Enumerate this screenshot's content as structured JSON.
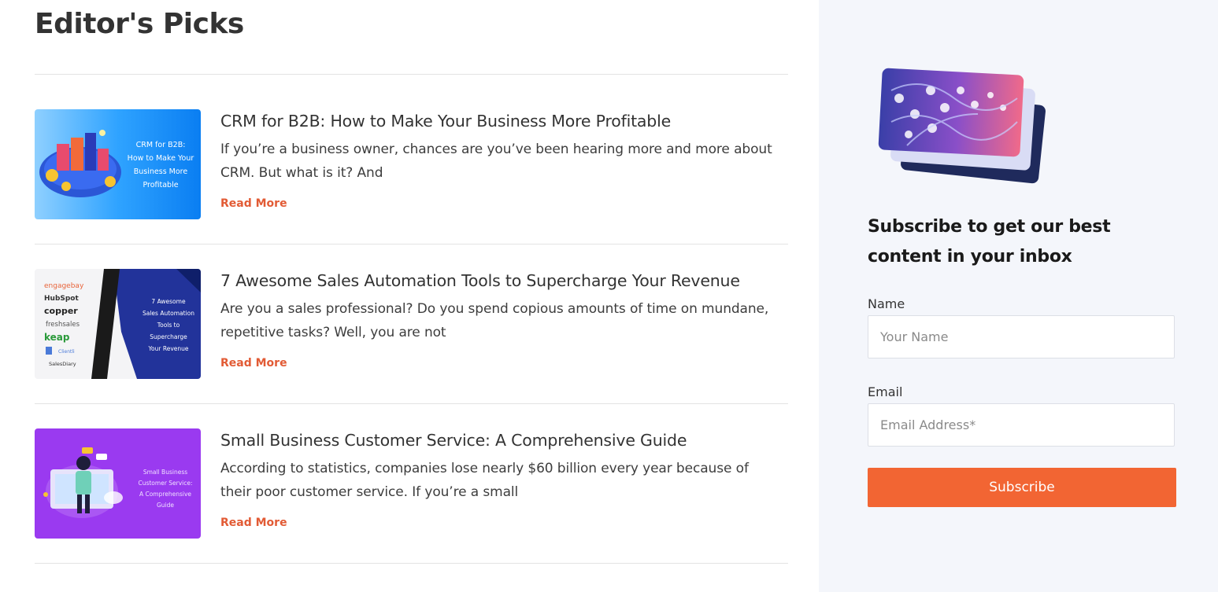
{
  "section_title": "Editor's Picks",
  "posts": [
    {
      "title": "CRM for B2B: How to Make Your Business More Profitable",
      "excerpt": "If you’re a business owner, chances are you’ve been hearing more and more about CRM. But what is it? And",
      "read_more": "Read More",
      "thumbnail": {
        "bg": "#2b9bf7",
        "lines": [
          "CRM for B2B:",
          "How to Make Your",
          "Business More",
          "Profitable"
        ]
      }
    },
    {
      "title": "7 Awesome Sales Automation Tools to Supercharge Your Revenue",
      "excerpt": "Are you a sales professional? Do you spend copious amounts of time on mundane, repetitive tasks? Well, you are not",
      "read_more": "Read More",
      "thumbnail": {
        "bg": "#22339a",
        "lines": [
          "7 Awesome",
          "Sales Automation",
          "Tools to",
          "Supercharge",
          "Your Revenue"
        ],
        "logos": [
          "engagebay",
          "HubSpot",
          "copper",
          "freshsales",
          "keap",
          "Clientli",
          "SalesDiary"
        ]
      }
    },
    {
      "title": "Small Business Customer Service: A Comprehensive Guide",
      "excerpt": "According to statistics, companies lose nearly $60 billion every year because of their poor customer service. If you’re a small",
      "read_more": "Read More",
      "thumbnail": {
        "bg": "#9a3af0",
        "lines": [
          "Small Business",
          "Customer Service:",
          "A Comprehensive",
          "Guide"
        ]
      }
    }
  ],
  "sidebar": {
    "heading": "Subscribe to get our best content in your inbox",
    "name_label": "Name",
    "name_placeholder": "Your Name",
    "email_label": "Email",
    "email_placeholder": "Email Address*",
    "button_label": "Subscribe"
  },
  "colors": {
    "accent": "#f26533",
    "read_more": "#e25b35",
    "sidebar_bg": "#f4f6fb"
  }
}
